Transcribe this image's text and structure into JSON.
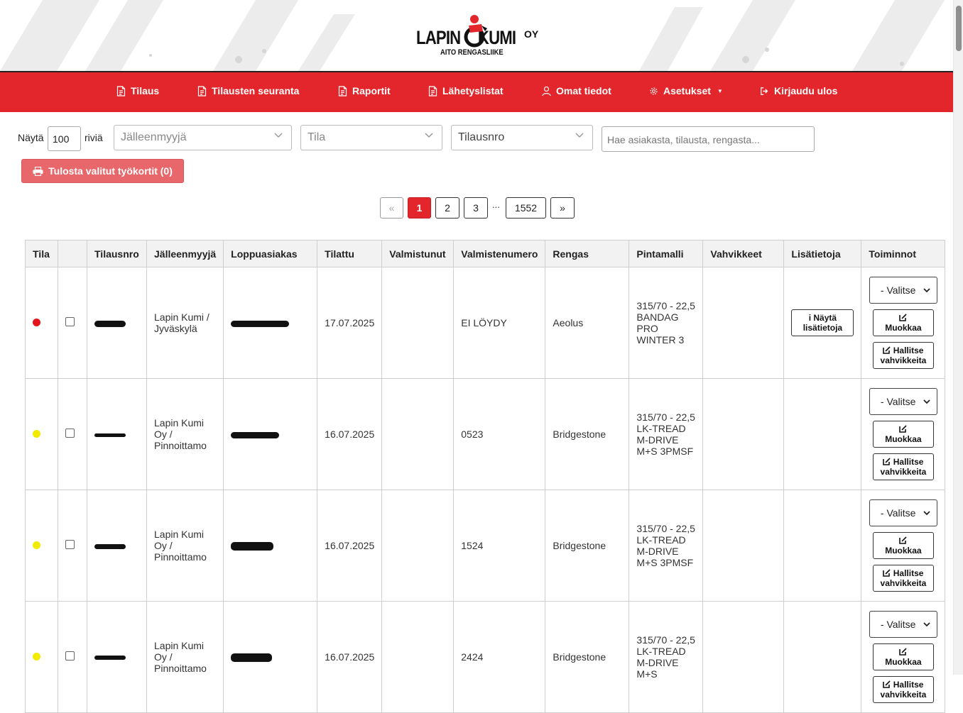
{
  "header": {
    "logo_main": "LAPIN",
    "logo_main2": "KUMI",
    "logo_oy": "OY",
    "logo_sub": "AITO RENGASLIIKE"
  },
  "nav": {
    "items": [
      {
        "label": "Tilaus",
        "icon": "document-icon"
      },
      {
        "label": "Tilausten seuranta",
        "icon": "document-icon"
      },
      {
        "label": "Raportit",
        "icon": "document-icon"
      },
      {
        "label": "Lähetyslistat",
        "icon": "document-icon"
      },
      {
        "label": "Omat tiedot",
        "icon": "user-icon"
      },
      {
        "label": "Asetukset",
        "icon": "gear-icon"
      },
      {
        "label": "Kirjaudu ulos",
        "icon": "logout-icon"
      }
    ]
  },
  "controls": {
    "show_label": "Näytä",
    "rows_value": "100",
    "rows_label": "riviä",
    "reseller_placeholder": "Jälleenmyyjä",
    "status_placeholder": "Tila",
    "order_no_placeholder": "Tilausnro",
    "search_placeholder": "Hae asiakasta, tilausta, rengasta...",
    "print_label": "Tulosta valitut työkortit (0)"
  },
  "pagination": {
    "prev": "«",
    "pages": [
      "1",
      "2",
      "3"
    ],
    "ellipsis": "...",
    "last": "1552",
    "next": "»"
  },
  "table": {
    "headers": [
      "Tila",
      "",
      "Tilausnro",
      "Jälleenmyyjä",
      "Loppuasiakas",
      "Tilattu",
      "Valmistunut",
      "Valmistenumero",
      "Rengas",
      "Pintamalli",
      "Vahvikkeet",
      "Lisätietoja",
      "Toiminnot"
    ],
    "rows": [
      {
        "status_color": "#e3151a",
        "reseller": "Lapin Kumi / Jyväskylä",
        "ordered": "17.07.2025",
        "finished": "",
        "mfg_no": "EI LÖYDY",
        "tire": "Aeolus",
        "tread": "315/70 - 22,5 BANDAG PRO WINTER 3",
        "reinforcements": "",
        "has_info": true
      },
      {
        "status_color": "#f2ea00",
        "reseller": "Lapin Kumi Oy / Pinnoittamo",
        "ordered": "16.07.2025",
        "finished": "",
        "mfg_no": "0523",
        "tire": "Bridgestone",
        "tread": "315/70 - 22,5 LK-TREAD M-DRIVE M+S 3PMSF",
        "reinforcements": "",
        "has_info": false
      },
      {
        "status_color": "#f2ea00",
        "reseller": "Lapin Kumi Oy / Pinnoittamo",
        "ordered": "16.07.2025",
        "finished": "",
        "mfg_no": "1524",
        "tire": "Bridgestone",
        "tread": "315/70 - 22,5 LK-TREAD M-DRIVE M+S 3PMSF",
        "reinforcements": "",
        "has_info": false
      },
      {
        "status_color": "#f2ea00",
        "reseller": "Lapin Kumi Oy / Pinnoittamo",
        "ordered": "16.07.2025",
        "finished": "",
        "mfg_no": "2424",
        "tire": "Bridgestone",
        "tread": "315/70 - 22,5 LK-TREAD M-DRIVE M+S",
        "reinforcements": "",
        "has_info": false
      }
    ],
    "info_button": "i Näytä lisätietoja",
    "action_select": "- Valitse",
    "edit_button": "Muokkaa",
    "manage_button": "Hallitse vahvikkeita"
  },
  "colors": {
    "brand_red": "#e3262b",
    "link": "#1a6fd0"
  }
}
